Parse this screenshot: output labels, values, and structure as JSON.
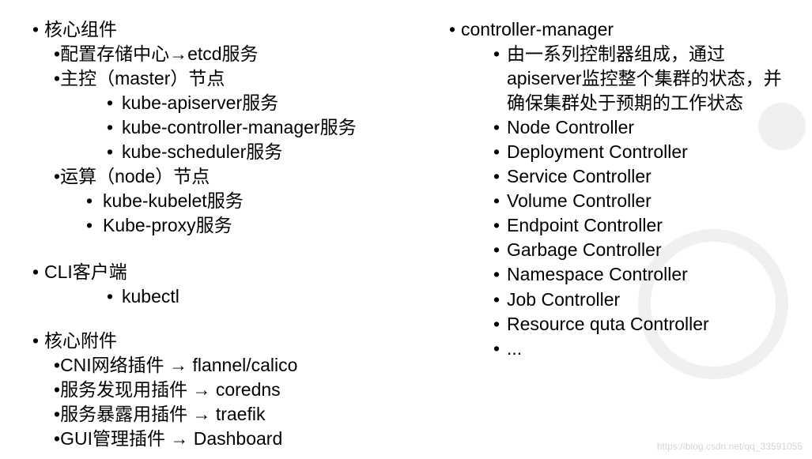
{
  "left": {
    "sec1_title": "核心组件",
    "sec1_items": {
      "cfg": "配置存储中心→etcd服务",
      "master": "主控（master）节点",
      "master_children": [
        "kube-apiserver服务",
        "kube-controller-manager服务",
        "kube-scheduler服务"
      ],
      "node": "运算（node）节点",
      "node_children": [
        "kube-kubelet服务",
        "Kube-proxy服务"
      ]
    },
    "sec2_title": "CLI客户端",
    "sec2_child": "kubectl",
    "sec3_title": "核心附件",
    "sec3_items": [
      "CNI网络插件 → flannel/calico",
      "服务发现用插件 → coredns",
      "服务暴露用插件 → traefik",
      "GUI管理插件 → Dashboard"
    ]
  },
  "right": {
    "title": "controller-manager",
    "desc": "由一系列控制器组成，通过apiserver监控整个集群的状态，并确保集群处于预期的工作状态",
    "items": [
      "Node Controller",
      "Deployment Controller",
      "Service Controller",
      "Volume Controller",
      "Endpoint Controller",
      "Garbage Controller",
      "Namespace Controller",
      "Job Controller",
      "Resource quta Controller",
      "..."
    ]
  },
  "watermark": "https://blog.csdn.net/qq_33591055"
}
